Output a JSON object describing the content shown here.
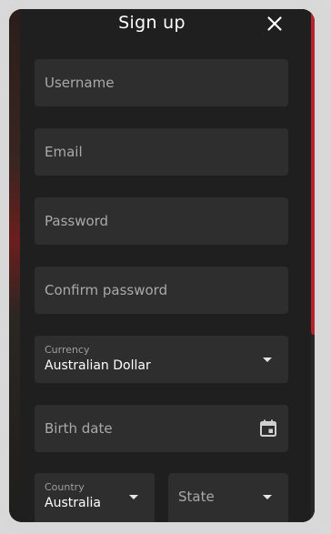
{
  "dialog": {
    "title": "Sign up",
    "close_icon": "close-icon"
  },
  "fields": {
    "username": {
      "placeholder": "Username"
    },
    "email": {
      "placeholder": "Email"
    },
    "password": {
      "placeholder": "Password"
    },
    "confirm_password": {
      "placeholder": "Confirm password"
    },
    "currency": {
      "label": "Currency",
      "value": "Australian Dollar"
    },
    "birth_date": {
      "placeholder": "Birth date",
      "icon": "calendar-icon"
    },
    "country": {
      "label": "Country",
      "value": "Australia"
    },
    "state": {
      "placeholder": "State"
    }
  },
  "colors": {
    "accent": "#b3242c",
    "dialog_bg": "#1f1f1f",
    "field_bg": "#2e2e2e",
    "text": "#ffffff",
    "placeholder": "#a9a9a9"
  }
}
